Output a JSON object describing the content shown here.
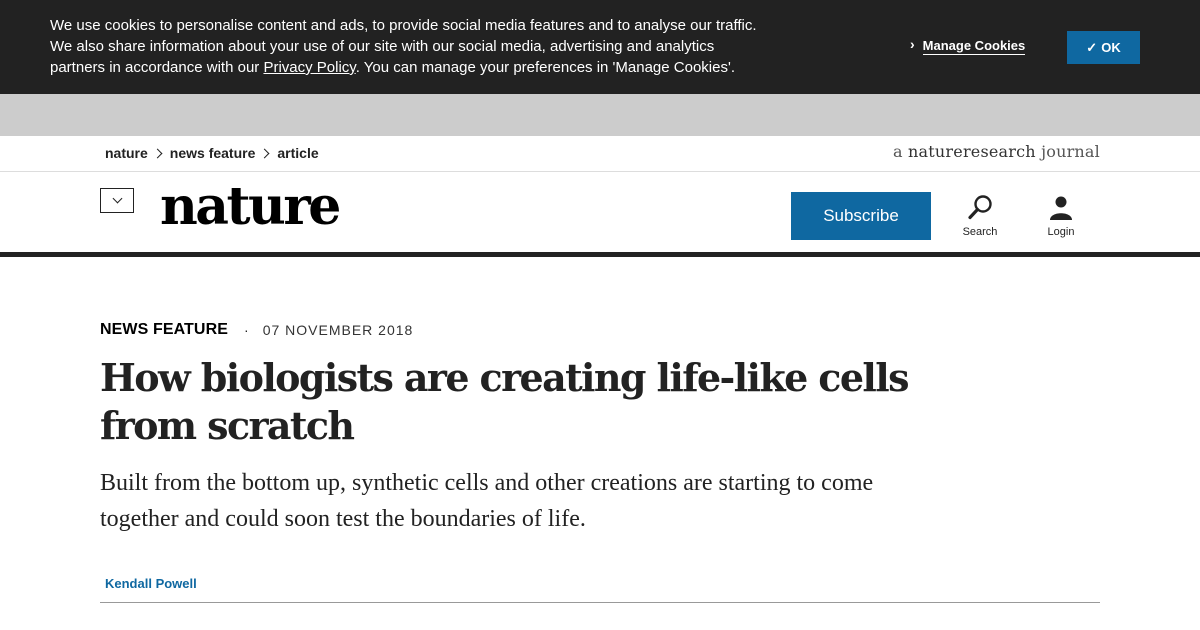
{
  "cookie_banner": {
    "text_line1": "We use cookies to personalise content and ads, to provide social media features and to analyse our traffic.",
    "text_line2": "We also share information about your use of our site with our social media, advertising and analytics",
    "text_line3_before": "partners in accordance with our ",
    "privacy_link": "Privacy Policy",
    "text_line3_after": ". You can manage your preferences in 'Manage Cookies'.",
    "manage_label": "Manage Cookies",
    "ok_label": "OK",
    "ok_check": "✓"
  },
  "breadcrumb": {
    "items": [
      "nature",
      "news feature",
      "article"
    ]
  },
  "journal_tag": {
    "prefix": "a ",
    "brand": "natureresearch",
    "suffix": " journal"
  },
  "header": {
    "logo": "nature",
    "subscribe_label": "Subscribe",
    "search_label": "Search",
    "login_label": "Login"
  },
  "article": {
    "type": "NEWS FEATURE",
    "separator": "·",
    "date": "07 NOVEMBER 2018",
    "title": "How biologists are creating life-like cells from scratch",
    "standfirst": "Built from the bottom up, synthetic cells and other creations are starting to come together and could soon test the boundaries of life.",
    "author": "Kendall Powell"
  },
  "colors": {
    "banner_bg": "#222222",
    "accent": "#0f68a1",
    "ad_strip": "#cccccc"
  },
  "icons": {
    "menu": "chevron-down-icon",
    "search": "search-icon",
    "login": "user-icon",
    "manage": "chevron-right-icon",
    "ok": "check-icon"
  }
}
